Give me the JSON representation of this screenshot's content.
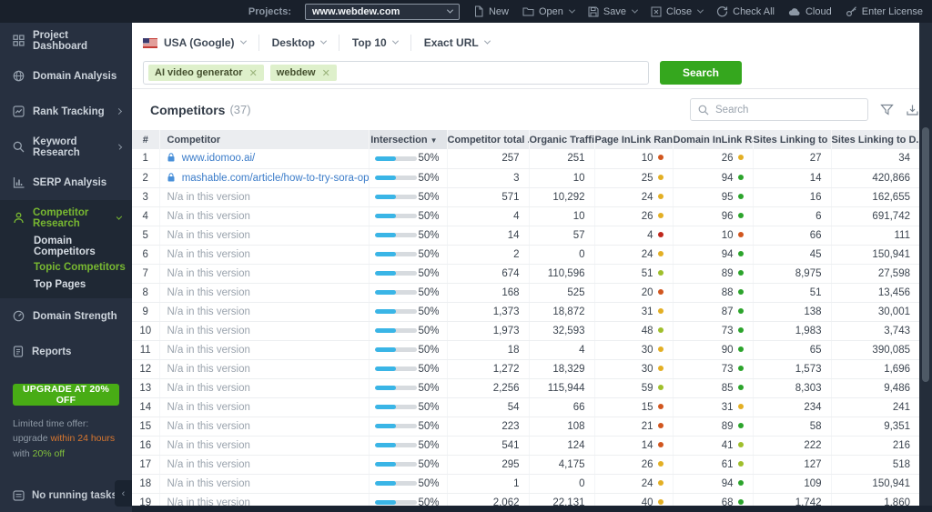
{
  "topbar": {
    "projects_label": "Projects:",
    "project_value": "www.webdew.com",
    "buttons": [
      {
        "label": "New",
        "caret": false
      },
      {
        "label": "Open",
        "caret": true
      },
      {
        "label": "Save",
        "caret": true
      },
      {
        "label": "Close",
        "caret": true
      },
      {
        "label": "Check All",
        "caret": false
      },
      {
        "label": "Cloud",
        "caret": false
      },
      {
        "label": "Enter License",
        "caret": false
      }
    ]
  },
  "sidebar": {
    "items": [
      {
        "label": "Project Dashboard"
      },
      {
        "label": "Domain Analysis"
      },
      {
        "label": "Rank Tracking"
      },
      {
        "label": "Keyword Research"
      },
      {
        "label": "SERP Analysis"
      },
      {
        "label": "Competitor Research"
      },
      {
        "label": "Domain Strength"
      },
      {
        "label": "Reports"
      }
    ],
    "submenu": [
      "Domain Competitors",
      "Topic Competitors",
      "Top Pages"
    ],
    "upgrade_button": "UPGRADE AT 20% OFF",
    "promo_1": "Limited time offer: upgrade",
    "promo_2": "within 24 hours",
    "promo_3": "with",
    "promo_4": "20% off",
    "status": "No running tasks"
  },
  "filters": [
    "USA (Google)",
    "Desktop",
    "Top 10",
    "Exact URL"
  ],
  "search": {
    "tags": [
      "AI video generator",
      "webdew"
    ],
    "button": "Search"
  },
  "competitors": {
    "title": "Competitors",
    "count": "(37)",
    "search_placeholder": "Search"
  },
  "table": {
    "columns": [
      "#",
      "Competitor",
      "Intersection",
      "Competitor total ...",
      "Organic Traffic",
      "Page InLink Rank",
      "Domain InLink Ra...",
      "Sites Linking to P...",
      "Sites Linking to D..."
    ],
    "rows": [
      {
        "num": "1",
        "competitor": "www.idomoo.ai/",
        "link": true,
        "intersection": "50%",
        "total": "257",
        "organic": "251",
        "pr": "10",
        "prc": "orange",
        "dr": "26",
        "drc": "yellow",
        "sp": "27",
        "sd": "34"
      },
      {
        "num": "2",
        "competitor": "mashable.com/article/how-to-try-sora-openai-...",
        "link": true,
        "intersection": "50%",
        "total": "3",
        "organic": "10",
        "pr": "25",
        "prc": "yellow",
        "dr": "94",
        "drc": "green",
        "sp": "14",
        "sd": "420,866"
      },
      {
        "num": "3",
        "competitor": "N/a in this version",
        "link": false,
        "intersection": "50%",
        "total": "571",
        "organic": "10,292",
        "pr": "24",
        "prc": "yellow",
        "dr": "95",
        "drc": "green",
        "sp": "16",
        "sd": "162,655"
      },
      {
        "num": "4",
        "competitor": "N/a in this version",
        "link": false,
        "intersection": "50%",
        "total": "4",
        "organic": "10",
        "pr": "26",
        "prc": "yellow",
        "dr": "96",
        "drc": "green",
        "sp": "6",
        "sd": "691,742"
      },
      {
        "num": "5",
        "competitor": "N/a in this version",
        "link": false,
        "intersection": "50%",
        "total": "14",
        "organic": "57",
        "pr": "4",
        "prc": "red",
        "dr": "10",
        "drc": "orange",
        "sp": "66",
        "sd": "111"
      },
      {
        "num": "6",
        "competitor": "N/a in this version",
        "link": false,
        "intersection": "50%",
        "total": "2",
        "organic": "0",
        "pr": "24",
        "prc": "yellow",
        "dr": "94",
        "drc": "green",
        "sp": "45",
        "sd": "150,941"
      },
      {
        "num": "7",
        "competitor": "N/a in this version",
        "link": false,
        "intersection": "50%",
        "total": "674",
        "organic": "110,596",
        "pr": "51",
        "prc": "lightgreen",
        "dr": "89",
        "drc": "green",
        "sp": "8,975",
        "sd": "27,598"
      },
      {
        "num": "8",
        "competitor": "N/a in this version",
        "link": false,
        "intersection": "50%",
        "total": "168",
        "organic": "525",
        "pr": "20",
        "prc": "orange",
        "dr": "88",
        "drc": "green",
        "sp": "51",
        "sd": "13,456"
      },
      {
        "num": "9",
        "competitor": "N/a in this version",
        "link": false,
        "intersection": "50%",
        "total": "1,373",
        "organic": "18,872",
        "pr": "31",
        "prc": "yellow",
        "dr": "87",
        "drc": "green",
        "sp": "138",
        "sd": "30,001"
      },
      {
        "num": "10",
        "competitor": "N/a in this version",
        "link": false,
        "intersection": "50%",
        "total": "1,973",
        "organic": "32,593",
        "pr": "48",
        "prc": "lightgreen",
        "dr": "73",
        "drc": "green",
        "sp": "1,983",
        "sd": "3,743"
      },
      {
        "num": "11",
        "competitor": "N/a in this version",
        "link": false,
        "intersection": "50%",
        "total": "18",
        "organic": "4",
        "pr": "30",
        "prc": "yellow",
        "dr": "90",
        "drc": "green",
        "sp": "65",
        "sd": "390,085"
      },
      {
        "num": "12",
        "competitor": "N/a in this version",
        "link": false,
        "intersection": "50%",
        "total": "1,272",
        "organic": "18,329",
        "pr": "30",
        "prc": "yellow",
        "dr": "73",
        "drc": "green",
        "sp": "1,573",
        "sd": "1,696"
      },
      {
        "num": "13",
        "competitor": "N/a in this version",
        "link": false,
        "intersection": "50%",
        "total": "2,256",
        "organic": "115,944",
        "pr": "59",
        "prc": "lightgreen",
        "dr": "85",
        "drc": "green",
        "sp": "8,303",
        "sd": "9,486"
      },
      {
        "num": "14",
        "competitor": "N/a in this version",
        "link": false,
        "intersection": "50%",
        "total": "54",
        "organic": "66",
        "pr": "15",
        "prc": "orange",
        "dr": "31",
        "drc": "yellow",
        "sp": "234",
        "sd": "241"
      },
      {
        "num": "15",
        "competitor": "N/a in this version",
        "link": false,
        "intersection": "50%",
        "total": "223",
        "organic": "108",
        "pr": "21",
        "prc": "orange",
        "dr": "89",
        "drc": "green",
        "sp": "58",
        "sd": "9,351"
      },
      {
        "num": "16",
        "competitor": "N/a in this version",
        "link": false,
        "intersection": "50%",
        "total": "541",
        "organic": "124",
        "pr": "14",
        "prc": "orange",
        "dr": "41",
        "drc": "lightgreen",
        "sp": "222",
        "sd": "216"
      },
      {
        "num": "17",
        "competitor": "N/a in this version",
        "link": false,
        "intersection": "50%",
        "total": "295",
        "organic": "4,175",
        "pr": "26",
        "prc": "yellow",
        "dr": "61",
        "drc": "lightgreen",
        "sp": "127",
        "sd": "518"
      },
      {
        "num": "18",
        "competitor": "N/a in this version",
        "link": false,
        "intersection": "50%",
        "total": "1",
        "organic": "0",
        "pr": "24",
        "prc": "yellow",
        "dr": "94",
        "drc": "green",
        "sp": "109",
        "sd": "150,941"
      },
      {
        "num": "19",
        "competitor": "N/a in this version",
        "link": false,
        "intersection": "50%",
        "total": "2,062",
        "organic": "22,131",
        "pr": "40",
        "prc": "yellow",
        "dr": "68",
        "drc": "green",
        "sp": "1,742",
        "sd": "1,860"
      }
    ]
  },
  "dot_colors": {
    "red": "#bf271c",
    "orange": "#d1561f",
    "yellow": "#e3af24",
    "lightgreen": "#a0bf2c",
    "green": "#2ca42c"
  },
  "colors": {
    "accent_green": "#35a71e",
    "sidebar_active_green": "#78b831",
    "link_blue": "#3b7cc9",
    "bar_fill": "#3ab5e6",
    "promo_orange": "#d9772f",
    "promo_green": "#82c13c"
  }
}
